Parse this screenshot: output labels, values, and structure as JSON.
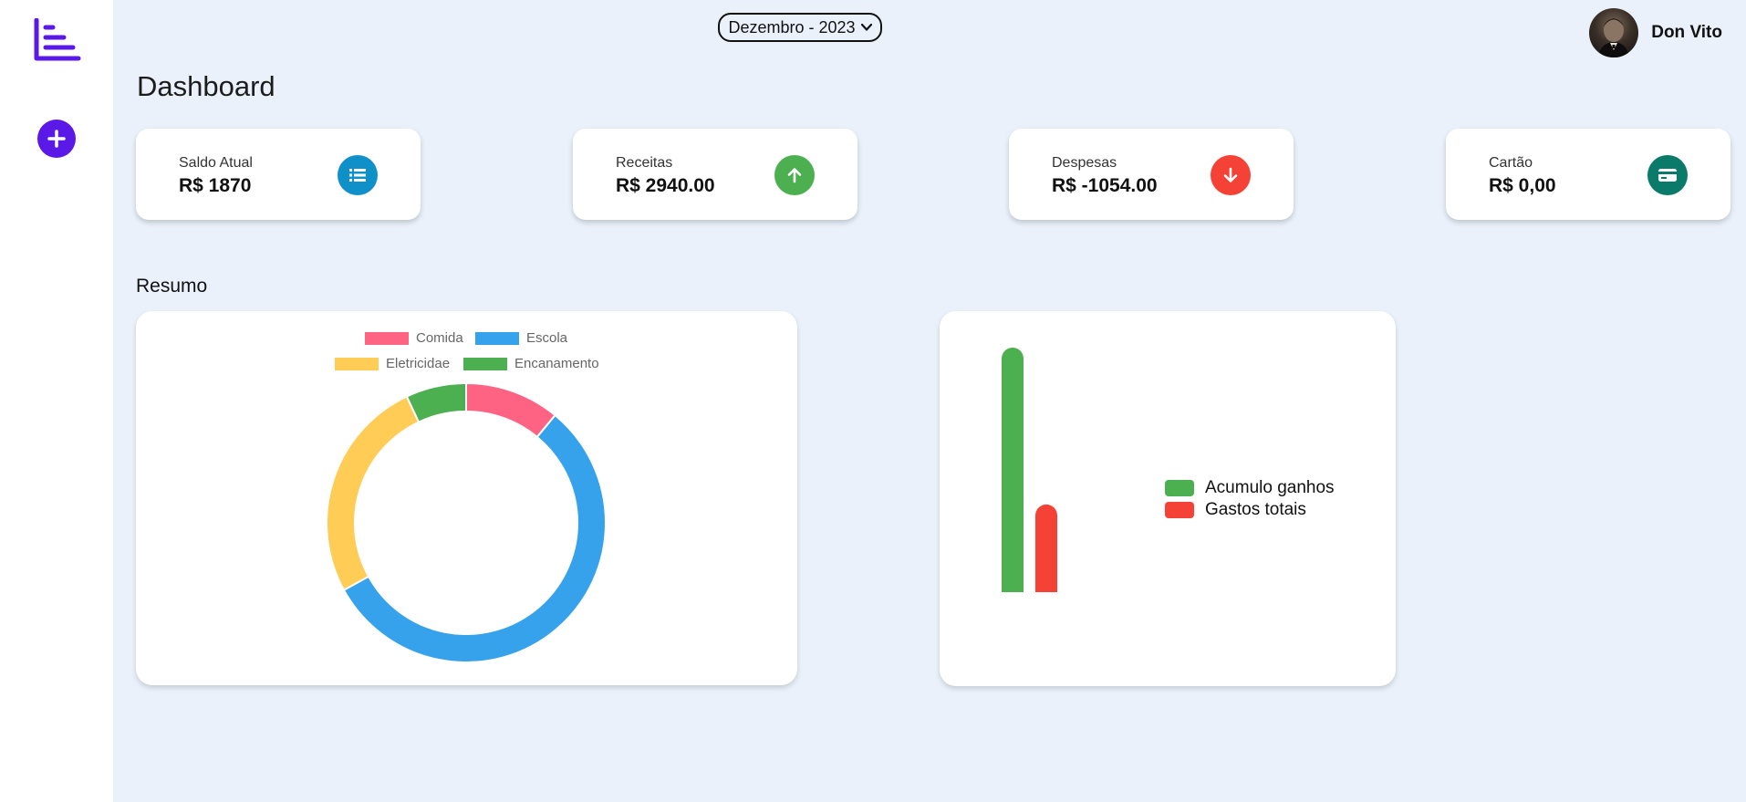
{
  "app": {
    "month_select": "Dezembro - 2023",
    "user_name": "Don Vito",
    "page_title": "Dashboard",
    "section_title": "Resumo"
  },
  "sidebar": {
    "icons": [
      "logo-icon",
      "add-icon"
    ]
  },
  "cards": [
    {
      "label": "Saldo Atual",
      "value": "R$ 1870",
      "icon": "list-icon",
      "color": "#0f90c8"
    },
    {
      "label": "Receitas",
      "value": "R$ 2940.00",
      "icon": "arrow-up-icon",
      "color": "#4caf50"
    },
    {
      "label": "Despesas",
      "value": "R$ -1054.00",
      "icon": "arrow-down-icon",
      "color": "#f44336"
    },
    {
      "label": "Cartão",
      "value": "R$ 0,00",
      "icon": "credit-card-icon",
      "color": "#0a7a6a"
    }
  ],
  "chart_data": [
    {
      "type": "pie",
      "variant": "doughnut",
      "categories": [
        "Comida",
        "Escola",
        "Eletricidae",
        "Encanamento"
      ],
      "values": [
        11,
        56,
        26,
        7
      ],
      "colors": [
        "#ff6384",
        "#36a2eb",
        "#ffcd56",
        "#4caf50"
      ],
      "legend": "top"
    },
    {
      "type": "bar",
      "categories": [
        "Acumulo ganhos",
        "Gastos totais"
      ],
      "values": [
        2940,
        1054
      ],
      "colors": [
        "#4caf50",
        "#f44336"
      ],
      "ylim": [
        0,
        2940
      ],
      "legend": "right",
      "grid": false
    }
  ]
}
